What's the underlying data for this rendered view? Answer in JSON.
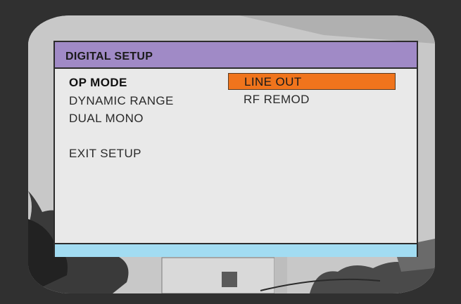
{
  "menu": {
    "title": "DIGITAL SETUP",
    "items": [
      {
        "label": "OP MODE",
        "selected": true
      },
      {
        "label": "DYNAMIC RANGE",
        "selected": false
      },
      {
        "label": "DUAL MONO",
        "selected": false
      },
      {
        "label": "EXIT SETUP",
        "selected": false
      }
    ]
  },
  "submenu": {
    "options": [
      {
        "label": "LINE OUT",
        "highlighted": true
      },
      {
        "label": "RF REMOD",
        "highlighted": false
      }
    ]
  },
  "colors": {
    "title_bar": "#a08ac6",
    "highlight": "#f0741c",
    "status_bar": "#a2dcf2",
    "panel": "#e9e9e9"
  }
}
